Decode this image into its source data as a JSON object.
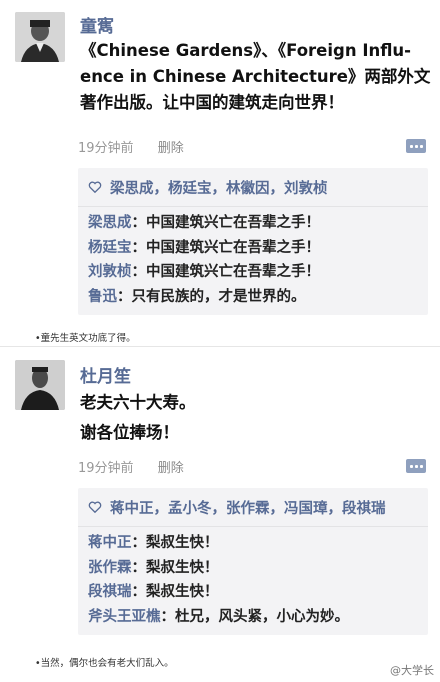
{
  "post1": {
    "author": "童寯",
    "content_lines": [
      "《Chinese Gardens》、《Foreign Influ-",
      "ence in Chinese Architecture》两部外文",
      "著作出版。让中国的建筑走向世界！"
    ],
    "time": "19分钟前",
    "delete_label": "删除",
    "likes": "梁思成，杨廷宝，林徽因，刘敦桢",
    "comments": [
      {
        "name": "梁思成",
        "text": "：中国建筑兴亡在吾辈之手！"
      },
      {
        "name": "杨廷宝",
        "text": "：中国建筑兴亡在吾辈之手！"
      },
      {
        "name": "刘敦桢",
        "text": "：中国建筑兴亡在吾辈之手！"
      },
      {
        "name": "鲁迅",
        "text": "：只有民族的，才是世界的。"
      }
    ],
    "caption": "•童先生英文功底了得。"
  },
  "post2": {
    "author": "杜月笙",
    "content_lines": [
      "老夫六十大寿。",
      "谢各位捧场！"
    ],
    "time": "19分钟前",
    "delete_label": "删除",
    "likes": "蒋中正，孟小冬，张作霖，冯国璋，段祺瑞",
    "comments": [
      {
        "name": "蒋中正",
        "text": "：梨叔生快！"
      },
      {
        "name": "张作霖",
        "text": "：梨叔生快！"
      },
      {
        "name": "段祺瑞",
        "text": "：梨叔生快！"
      },
      {
        "name": "斧头王亚樵",
        "text": "：杜兄，风头紧，小心为妙。"
      }
    ],
    "caption": "•当然，偶尔也会有老大们乱入。"
  },
  "watermark": "@大学长",
  "colors": {
    "link": "#576b95",
    "likebox_bg": "#f3f3f5",
    "meta": "#999999"
  }
}
